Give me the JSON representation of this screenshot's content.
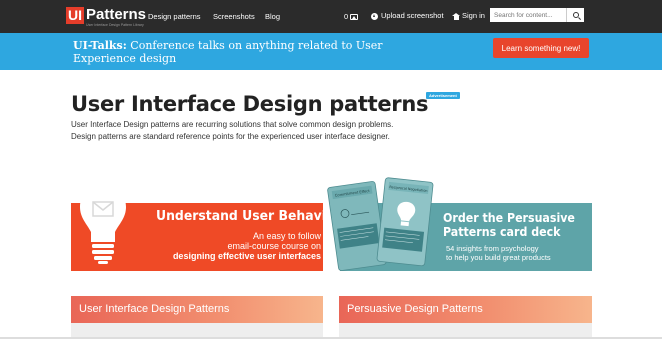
{
  "nav": {
    "logo_ui": "UI",
    "logo_word": "Patterns",
    "logo_tagline": "User Interface Design Pattern Library",
    "links": [
      "Design patterns",
      "Screenshots",
      "Blog"
    ],
    "count": "0",
    "upload_label": "Upload screenshot",
    "signin_label": "Sign in",
    "search_placeholder": "Search for content..."
  },
  "promo": {
    "bold": "UI-Talks:",
    "text": " Conference talks on anything related to User Experience design",
    "button": "Learn something new!"
  },
  "main": {
    "ad_badge": "Advertisement",
    "title": "User Interface Design patterns",
    "intro": "User Interface Design patterns are recurring solutions that solve common design problems. Design patterns are standard reference points for the experienced user interface designer."
  },
  "banner_left": {
    "title": "Understand User Behavior",
    "line1": "An easy to follow",
    "line2": "email-course course on",
    "line3": "designing effective user interfaces",
    "color": "#ef4a26"
  },
  "banner_right": {
    "title_line1": "Order the Persuasive",
    "title_line2": "Patterns card deck",
    "sub_line1": "54 insights from psychology",
    "sub_line2": "to help you build great products",
    "card1_title": "Commitment Effect",
    "card2_title": "Reciprocal Negotiation",
    "color": "#5ea4a8"
  },
  "sections": {
    "left": "User Interface Design Patterns",
    "right": "Persuasive Design Patterns"
  },
  "colors": {
    "nav_bg": "#2b2b2b",
    "promo_bg": "#2ea7e0",
    "accent": "#e8452c"
  }
}
